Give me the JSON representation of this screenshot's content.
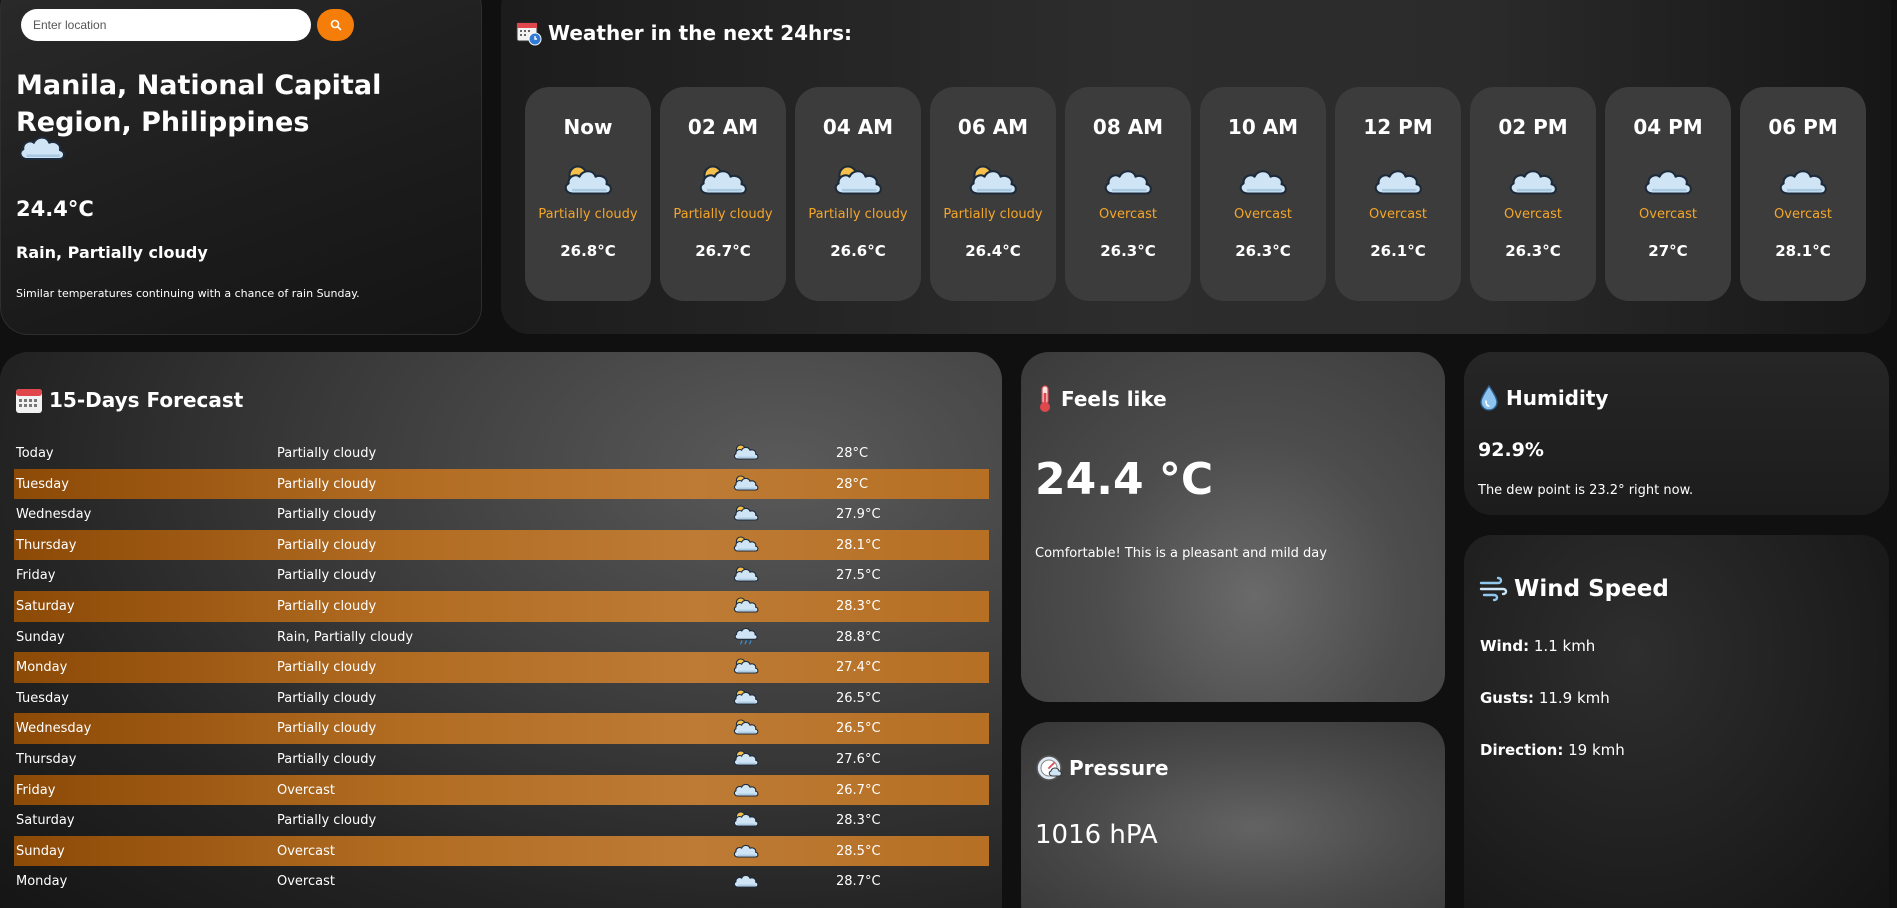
{
  "search": {
    "placeholder": "Enter location",
    "button_icon": "search-icon"
  },
  "current": {
    "city": "Manila, National Capital Region, Philippines",
    "icon": "cloud-icon",
    "temperature": "24.4°C",
    "condition": "Rain, Partially cloudy",
    "description": "Similar temperatures continuing with a chance of rain Sunday."
  },
  "hourly": {
    "title": "Weather in the next 24hrs:",
    "icon": "calendar-clock-icon",
    "items": [
      {
        "time": "Now",
        "condition": "Partially cloudy",
        "temp": "26.8°C",
        "icon": "partly-cloudy-night-icon"
      },
      {
        "time": "02 AM",
        "condition": "Partially cloudy",
        "temp": "26.7°C",
        "icon": "partly-cloudy-night-icon"
      },
      {
        "time": "04 AM",
        "condition": "Partially cloudy",
        "temp": "26.6°C",
        "icon": "partly-cloudy-night-icon"
      },
      {
        "time": "06 AM",
        "condition": "Partially cloudy",
        "temp": "26.4°C",
        "icon": "partly-cloudy-night-icon"
      },
      {
        "time": "08 AM",
        "condition": "Overcast",
        "temp": "26.3°C",
        "icon": "cloud-icon"
      },
      {
        "time": "10 AM",
        "condition": "Overcast",
        "temp": "26.3°C",
        "icon": "cloud-icon"
      },
      {
        "time": "12 PM",
        "condition": "Overcast",
        "temp": "26.1°C",
        "icon": "cloud-icon"
      },
      {
        "time": "02 PM",
        "condition": "Overcast",
        "temp": "26.3°C",
        "icon": "cloud-icon"
      },
      {
        "time": "04 PM",
        "condition": "Overcast",
        "temp": "27°C",
        "icon": "cloud-icon"
      },
      {
        "time": "06 PM",
        "condition": "Overcast",
        "temp": "28.1°C",
        "icon": "cloud-icon"
      }
    ]
  },
  "forecast": {
    "title": "15-Days Forecast",
    "icon": "calendar-icon",
    "days": [
      {
        "day": "Today",
        "condition": "Partially cloudy",
        "temp": "28°C",
        "icon": "partly-cloudy-day-icon"
      },
      {
        "day": "Tuesday",
        "condition": "Partially cloudy",
        "temp": "28°C",
        "icon": "partly-cloudy-day-icon"
      },
      {
        "day": "Wednesday",
        "condition": "Partially cloudy",
        "temp": "27.9°C",
        "icon": "partly-cloudy-day-icon"
      },
      {
        "day": "Thursday",
        "condition": "Partially cloudy",
        "temp": "28.1°C",
        "icon": "partly-cloudy-day-icon"
      },
      {
        "day": "Friday",
        "condition": "Partially cloudy",
        "temp": "27.5°C",
        "icon": "partly-cloudy-day-icon"
      },
      {
        "day": "Saturday",
        "condition": "Partially cloudy",
        "temp": "28.3°C",
        "icon": "partly-cloudy-day-icon"
      },
      {
        "day": "Sunday",
        "condition": "Rain, Partially cloudy",
        "temp": "28.8°C",
        "icon": "rain-cloud-icon"
      },
      {
        "day": "Monday",
        "condition": "Partially cloudy",
        "temp": "27.4°C",
        "icon": "partly-cloudy-day-icon"
      },
      {
        "day": "Tuesday",
        "condition": "Partially cloudy",
        "temp": "26.5°C",
        "icon": "partly-cloudy-day-icon"
      },
      {
        "day": "Wednesday",
        "condition": "Partially cloudy",
        "temp": "26.5°C",
        "icon": "partly-cloudy-day-icon"
      },
      {
        "day": "Thursday",
        "condition": "Partially cloudy",
        "temp": "27.6°C",
        "icon": "partly-cloudy-day-icon"
      },
      {
        "day": "Friday",
        "condition": "Overcast",
        "temp": "26.7°C",
        "icon": "cloud-icon"
      },
      {
        "day": "Saturday",
        "condition": "Partially cloudy",
        "temp": "28.3°C",
        "icon": "partly-cloudy-day-icon"
      },
      {
        "day": "Sunday",
        "condition": "Overcast",
        "temp": "28.5°C",
        "icon": "cloud-icon"
      },
      {
        "day": "Monday",
        "condition": "Overcast",
        "temp": "28.7°C",
        "icon": "cloud-icon"
      }
    ]
  },
  "feels_like": {
    "title": "Feels like",
    "icon": "thermometer-icon",
    "value": "24.4 °C",
    "description": "Comfortable! This is a pleasant and mild day"
  },
  "pressure": {
    "title": "Pressure",
    "icon": "barometer-icon",
    "value": "1016 hPA"
  },
  "humidity": {
    "title": "Humidity",
    "icon": "water-drop-icon",
    "value": "92.9%",
    "description": "The dew point is 23.2° right now."
  },
  "wind": {
    "title": "Wind Speed",
    "icon": "wind-icon",
    "wind_label": "Wind:",
    "wind_value": "1.1 kmh",
    "gusts_label": "Gusts:",
    "gusts_value": "11.9 kmh",
    "direction_label": "Direction:",
    "direction_value": "19 kmh"
  },
  "colors": {
    "accent": "#f57d0a",
    "condition_text": "#f4a62a",
    "row_highlight": "#b26c22",
    "card_bg": "#3c3c3c"
  }
}
